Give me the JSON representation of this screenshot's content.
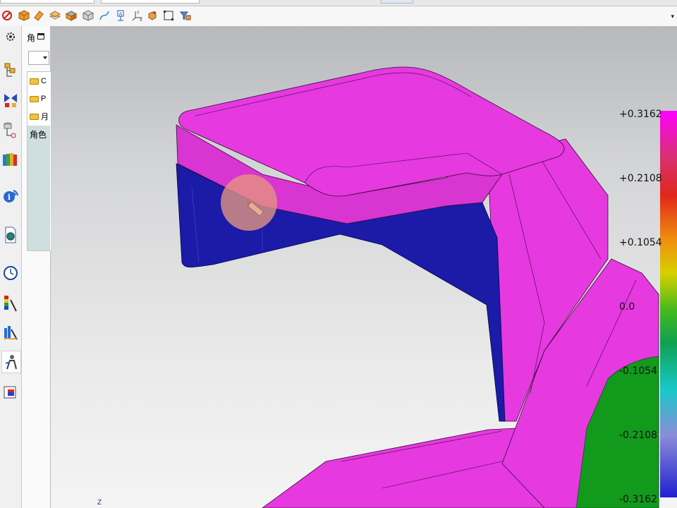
{
  "topbar": {
    "boxes": [
      {
        "name": "top-field-1"
      },
      {
        "name": "top-field-2"
      },
      {
        "name": "top-field-3"
      }
    ]
  },
  "toolbar": {
    "icons": [
      "forbid-icon",
      "solid-box-icon",
      "shade-icon",
      "layer-icon",
      "extrude-icon",
      "cube-icon",
      "curve-icon",
      "text-note-icon",
      "axis-triad-icon",
      "part-cube-icon",
      "rectangle-select-icon",
      "filter-icon"
    ],
    "more_glyph": "▾"
  },
  "resource_bar": {
    "items": [
      {
        "icon": "gear-icon"
      },
      {
        "icon": "assembly-nav-icon"
      },
      {
        "icon": "constraint-nav-icon"
      },
      {
        "icon": "part-nav-icon"
      },
      {
        "icon": "reuse-library-icon"
      },
      {
        "icon": "info-icon"
      },
      {
        "icon": "web-browser-icon"
      },
      {
        "icon": "history-icon"
      },
      {
        "icon": "palette-icon"
      },
      {
        "icon": "analysis-icon"
      },
      {
        "icon": "role-icon"
      },
      {
        "icon": "system-visualization-icon"
      }
    ]
  },
  "nav_panel": {
    "title": "角",
    "list": [
      {
        "label": "C"
      },
      {
        "label": "P"
      },
      {
        "label": "月"
      }
    ],
    "selected_label": "角色"
  },
  "viewport": {
    "axis_label": "Z",
    "color_scale": {
      "labels": [
        "+0.3162",
        "+0.2108",
        "+0.1054",
        "0.0",
        "-0.1054",
        "-0.2108",
        "-0.3162"
      ],
      "top_color": "#ff00ff",
      "bottom_color": "#2020d0"
    },
    "colors": {
      "surface_magenta": "#e639e0",
      "surface_blue": "#1b1ba8",
      "surface_green": "#129a1c"
    }
  }
}
